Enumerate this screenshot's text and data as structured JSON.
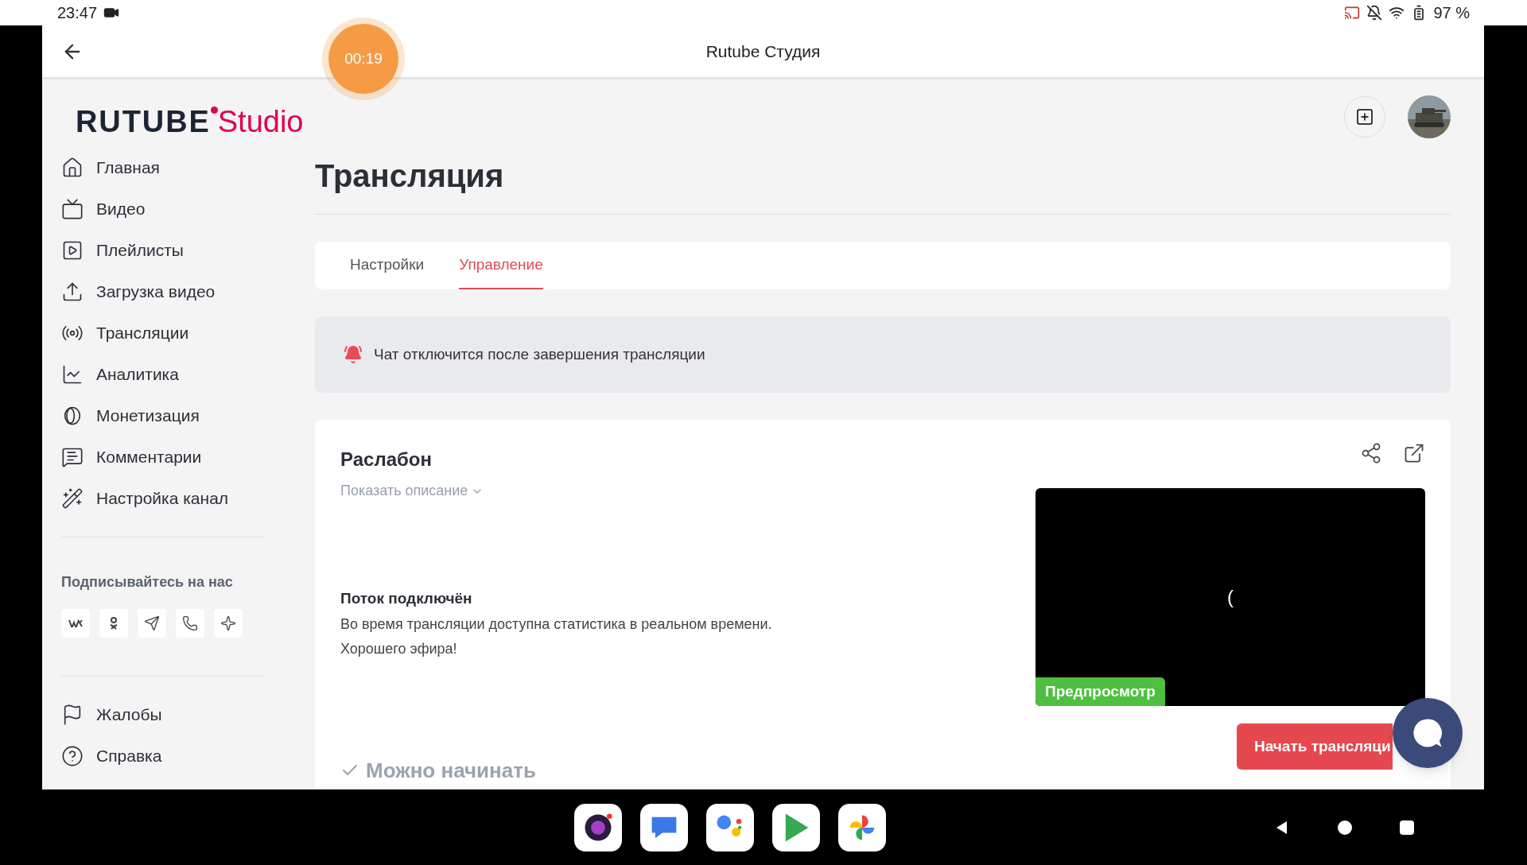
{
  "status_bar": {
    "time": "23:47",
    "battery": "97 %"
  },
  "app_bar": {
    "title": "Rutube Студия",
    "timer": "00:19"
  },
  "sidebar": {
    "logo": {
      "brand": "RUTUBE",
      "product": "Studio"
    },
    "items": [
      {
        "label": "Главная"
      },
      {
        "label": "Видео"
      },
      {
        "label": "Плейлисты"
      },
      {
        "label": "Загрузка видео"
      },
      {
        "label": "Трансляции"
      },
      {
        "label": "Аналитика"
      },
      {
        "label": "Монетизация"
      },
      {
        "label": "Комментарии"
      },
      {
        "label": "Настройка канал"
      }
    ],
    "follow_title": "Подписывайтесь на нас",
    "footer_items": [
      {
        "label": "Жалобы"
      },
      {
        "label": "Справка"
      }
    ]
  },
  "page": {
    "title": "Трансляция",
    "tabs": [
      {
        "label": "Настройки",
        "selected": false
      },
      {
        "label": "Управление",
        "selected": true
      }
    ],
    "alert": "Чат отключится после завершения трансляции",
    "stream": {
      "title": "Раслабон",
      "show_description": "Показать описание",
      "status_title": "Поток подключён",
      "status_lines": [
        "Во время трансляции доступна статистика в реальном времени.",
        "Хорошего эфира!"
      ],
      "preview_glyph": "(",
      "preview_badge": "Предпросмотр",
      "ready_label": "Можно начинать",
      "start_button": "Начать трансляци"
    }
  }
}
